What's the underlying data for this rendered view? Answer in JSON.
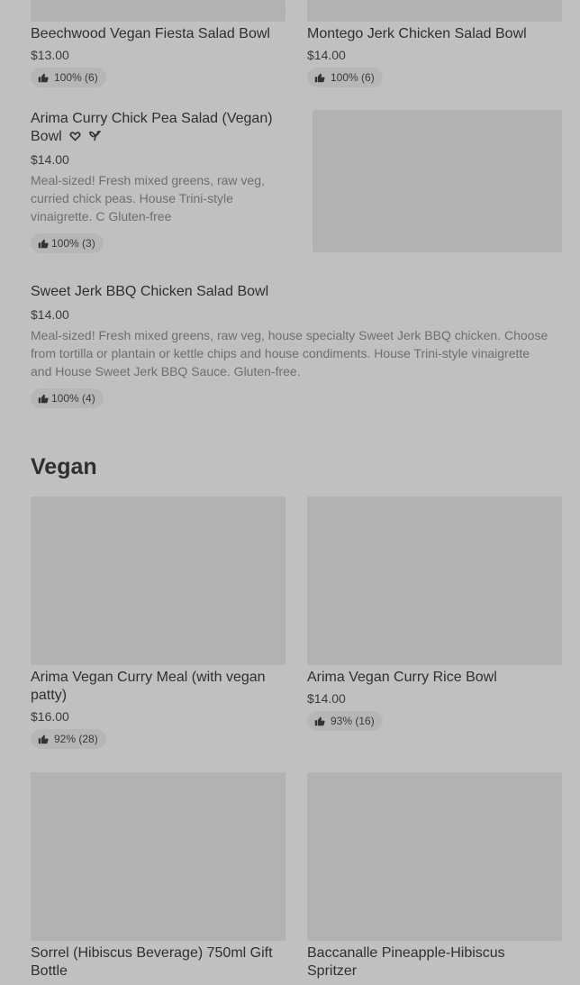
{
  "items": {
    "beechwood": {
      "title": "Beechwood Vegan Fiesta Salad Bowl",
      "price": "$13.00",
      "rating": "100% (6)"
    },
    "montego": {
      "title": "Montego Jerk Chicken Salad Bowl",
      "price": "$14.00",
      "rating": "100% (6)"
    },
    "arima_salad": {
      "title_line1": "Arima Curry Chick Pea Salad (Vegan)",
      "title_line2": "Bowl",
      "price": "$14.00",
      "desc_line1": "Meal-sized! Fresh mixed greens, raw veg,",
      "desc_line2": "curried chick peas. House Trini-style",
      "desc_line3": "vinaigrette. C Gluten-free",
      "rating": "100% (3)"
    },
    "sweet_jerk": {
      "title": "Sweet Jerk BBQ Chicken Salad Bowl",
      "price": "$14.00",
      "desc_line1": "Meal-sized! Fresh mixed greens, raw veg, house specialty Sweet Jerk BBQ chicken. Choose",
      "desc_line2": "from tortilla or plantain or kettle chips and house condiments. House Trini-style vinaigrette",
      "desc_line3": "and House Sweet Jerk BBQ Sauce. Gluten-free.",
      "rating": "100% (4)"
    },
    "arima_meal": {
      "title_line1": "Arima Vegan Curry Meal (with vegan",
      "title_line2": "patty)",
      "price": "$16.00",
      "rating": "92% (28)"
    },
    "arima_rice": {
      "title": "Arima Vegan Curry Rice Bowl",
      "price": "$14.00",
      "rating": "93% (16)"
    },
    "sorrel": {
      "title_line1": "Sorrel (Hibiscus Beverage) 750ml Gift",
      "title_line2": "Bottle"
    },
    "baccanalle": {
      "title_line1": "Baccanalle Pineapple-Hibiscus",
      "title_line2": "Spritzer"
    }
  },
  "sections": {
    "vegan": "Vegan"
  },
  "icons": {
    "rating": "thumbs-up-icon",
    "heart": "heart-icon",
    "vegan": "leaf-icon"
  },
  "colors": {
    "background": "#c0c0c0",
    "image_placeholder": "#b2b2b2",
    "badge_bg": "#b6b6b6",
    "text": "#2f2f2f",
    "description": "#6e6e6e"
  }
}
